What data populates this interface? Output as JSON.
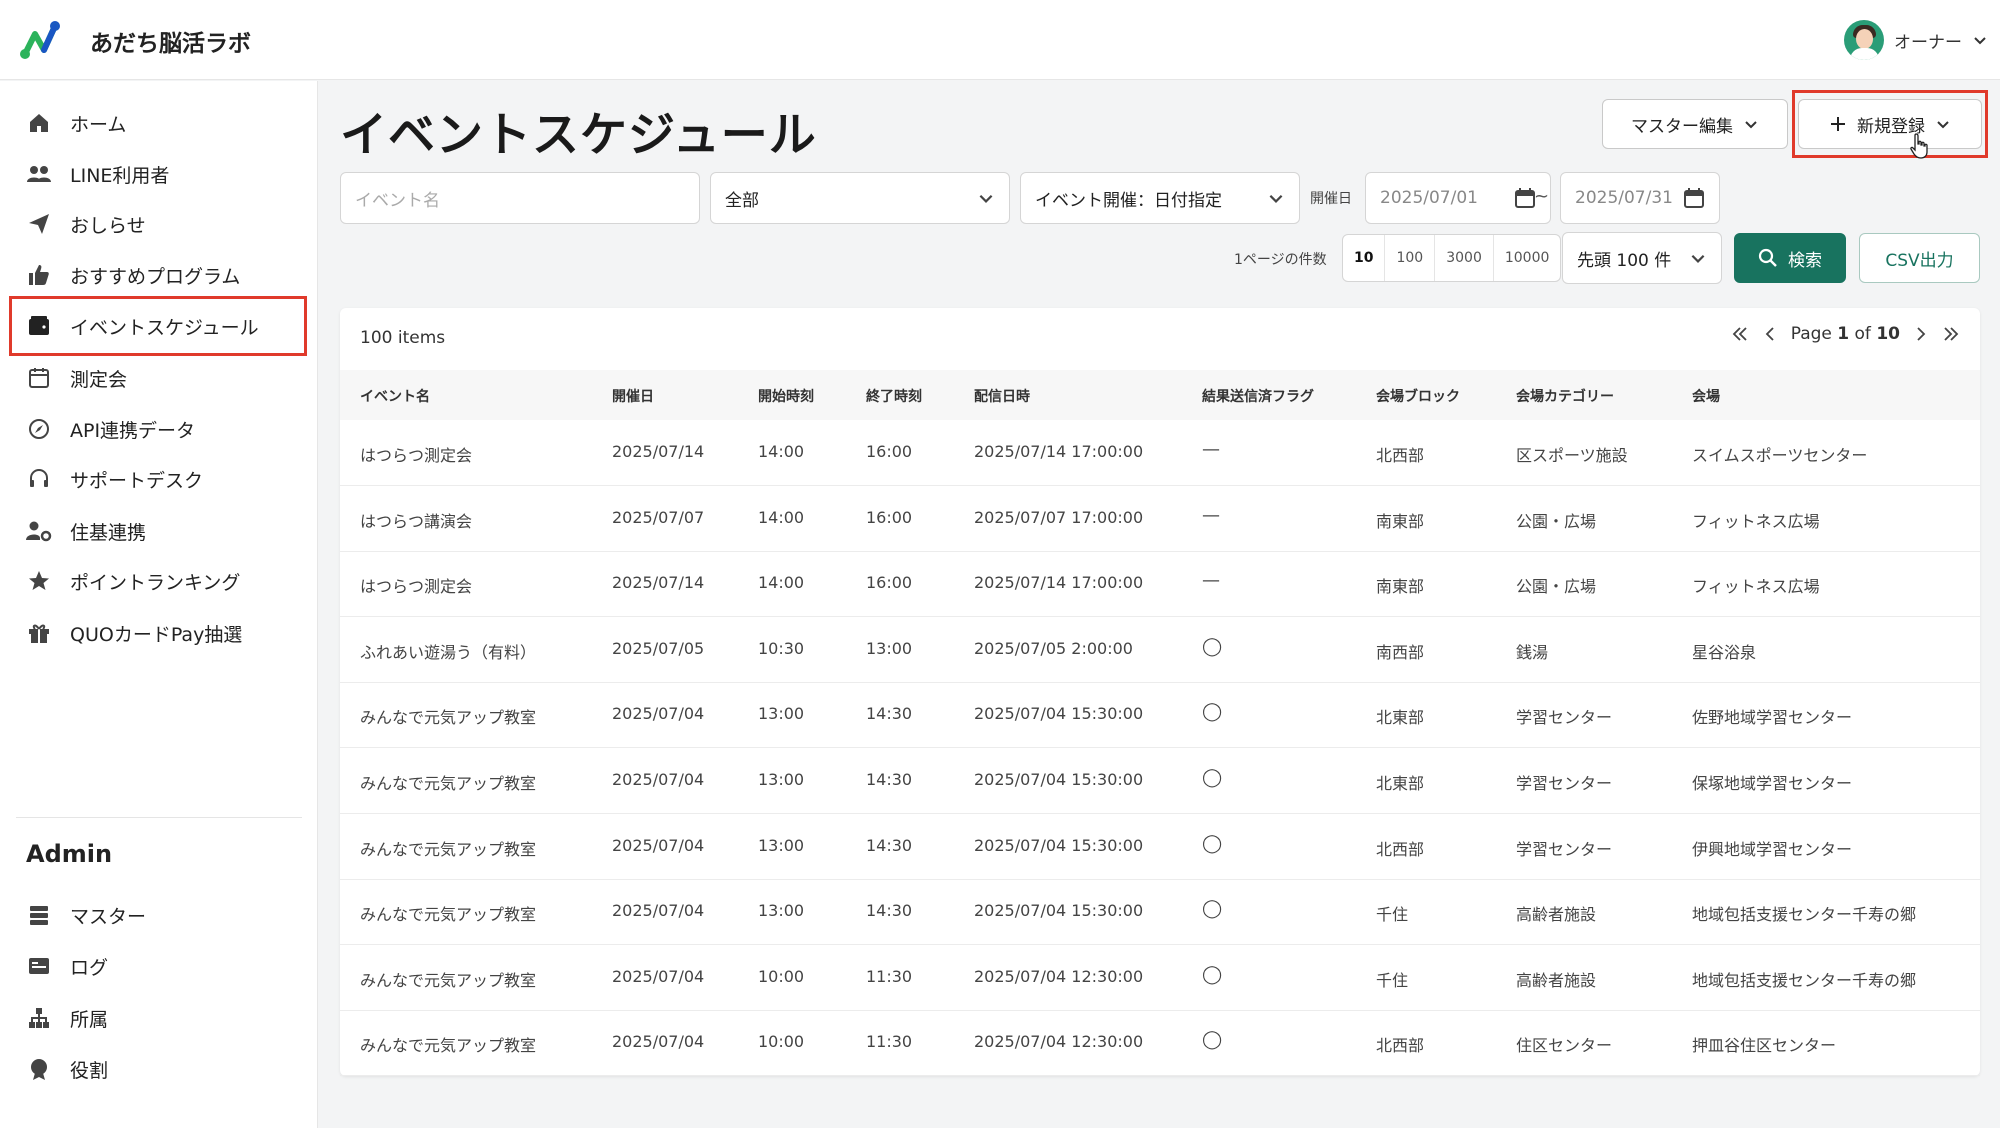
{
  "header": {
    "app_title": "あだち脳活ラボ",
    "user_name": "オーナー"
  },
  "colors": {
    "brand": "#18735f",
    "highlight": "#e03a2b",
    "logo_green": "#2bb35b",
    "logo_blue": "#1a56c4"
  },
  "sidebar": {
    "items": [
      {
        "label": "ホーム",
        "icon": "home-icon"
      },
      {
        "label": "LINE利用者",
        "icon": "users-icon"
      },
      {
        "label": "おしらせ",
        "icon": "paper-plane-icon"
      },
      {
        "label": "おすすめプログラム",
        "icon": "thumbs-up-icon"
      },
      {
        "label": "イベントスケジュール",
        "icon": "wallet-icon",
        "active": true
      },
      {
        "label": "測定会",
        "icon": "calendar-icon"
      },
      {
        "label": "API連携データ",
        "icon": "compass-icon"
      },
      {
        "label": "サポートデスク",
        "icon": "headset-icon"
      },
      {
        "label": "住基連携",
        "icon": "user-gear-icon"
      },
      {
        "label": "ポイントランキング",
        "icon": "star-icon"
      },
      {
        "label": "QUOカードPay抽選",
        "icon": "gift-icon"
      }
    ],
    "admin_title": "Admin",
    "admin_items": [
      {
        "label": "マスター",
        "icon": "database-icon"
      },
      {
        "label": "ログ",
        "icon": "log-icon"
      },
      {
        "label": "所属",
        "icon": "org-chart-icon"
      },
      {
        "label": "役割",
        "icon": "badge-icon"
      }
    ]
  },
  "main": {
    "title": "イベントスケジュール",
    "master_edit_label": "マスター編集",
    "new_label": "新規登録",
    "filters": {
      "event_name_placeholder": "イベント名",
      "category_value": "全部",
      "date_mode_value": "イベント開催：日付指定",
      "date_label": "開催日",
      "date_from": "2025/07/01",
      "tilde": "~",
      "date_to": "2025/07/31"
    },
    "page_size_label": "1ページの件数",
    "page_size_options": [
      "10",
      "100",
      "3000",
      "10000"
    ],
    "page_size_selected": "10",
    "limit_value": "先頭 100 件",
    "search_label": "検索",
    "csv_label": "CSV出力"
  },
  "table": {
    "items_count": "100 items",
    "page_prefix": "Page",
    "page_current": "1",
    "page_of": "of",
    "page_total": "10",
    "columns": [
      "イベント名",
      "開催日",
      "開始時刻",
      "終了時刻",
      "配信日時",
      "結果送信済フラグ",
      "会場ブロック",
      "会場カテゴリー",
      "会場"
    ],
    "rows": [
      [
        "はつらつ測定会",
        "2025/07/14",
        "14:00",
        "16:00",
        "2025/07/14 17:00:00",
        "—",
        "北西部",
        "区スポーツ施設",
        "スイムスポーツセンター"
      ],
      [
        "はつらつ講演会",
        "2025/07/07",
        "14:00",
        "16:00",
        "2025/07/07 17:00:00",
        "—",
        "南東部",
        "公園・広場",
        "フィットネス広場"
      ],
      [
        "はつらつ測定会",
        "2025/07/14",
        "14:00",
        "16:00",
        "2025/07/14 17:00:00",
        "—",
        "南東部",
        "公園・広場",
        "フィットネス広場"
      ],
      [
        "ふれあい遊湯う（有料）",
        "2025/07/05",
        "10:30",
        "13:00",
        "2025/07/05 2:00:00",
        "◯",
        "南西部",
        "銭湯",
        "星谷浴泉"
      ],
      [
        "みんなで元気アップ教室",
        "2025/07/04",
        "13:00",
        "14:30",
        "2025/07/04 15:30:00",
        "◯",
        "北東部",
        "学習センター",
        "佐野地域学習センター"
      ],
      [
        "みんなで元気アップ教室",
        "2025/07/04",
        "13:00",
        "14:30",
        "2025/07/04 15:30:00",
        "◯",
        "北東部",
        "学習センター",
        "保塚地域学習センター"
      ],
      [
        "みんなで元気アップ教室",
        "2025/07/04",
        "13:00",
        "14:30",
        "2025/07/04 15:30:00",
        "◯",
        "北西部",
        "学習センター",
        "伊興地域学習センター"
      ],
      [
        "みんなで元気アップ教室",
        "2025/07/04",
        "13:00",
        "14:30",
        "2025/07/04 15:30:00",
        "◯",
        "千住",
        "高齢者施設",
        "地域包括支援センター千寿の郷"
      ],
      [
        "みんなで元気アップ教室",
        "2025/07/04",
        "10:00",
        "11:30",
        "2025/07/04 12:30:00",
        "◯",
        "千住",
        "高齢者施設",
        "地域包括支援センター千寿の郷"
      ],
      [
        "みんなで元気アップ教室",
        "2025/07/04",
        "10:00",
        "11:30",
        "2025/07/04 12:30:00",
        "◯",
        "北西部",
        "住区センター",
        "押皿谷住区センター"
      ]
    ]
  }
}
